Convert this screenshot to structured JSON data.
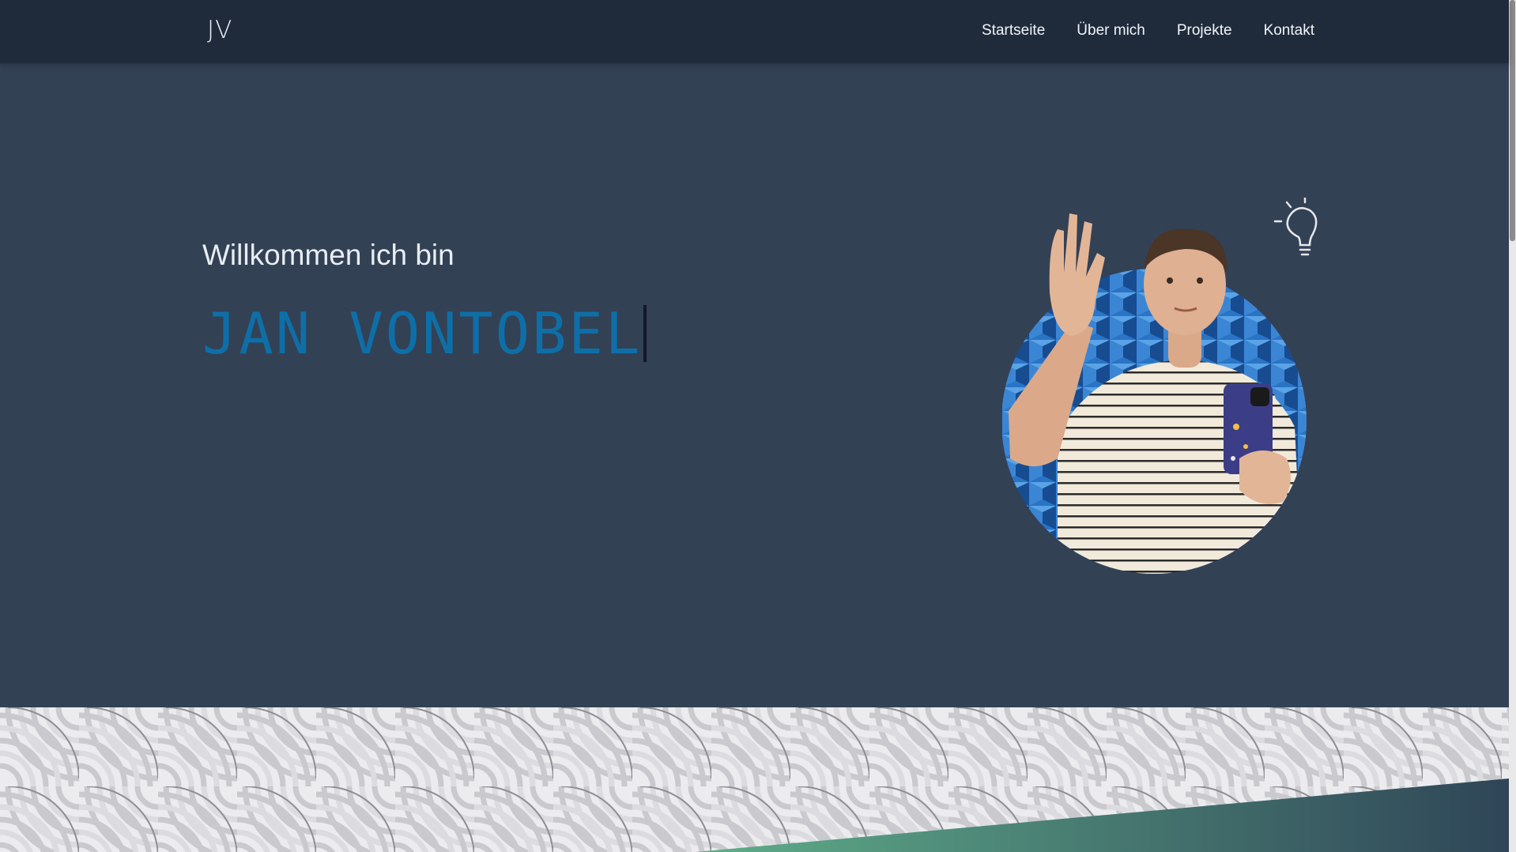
{
  "header": {
    "logo": "JV",
    "nav": [
      {
        "label": "Startseite"
      },
      {
        "label": "Über mich"
      },
      {
        "label": "Projekte"
      },
      {
        "label": "Kontakt"
      }
    ]
  },
  "hero": {
    "greeting": "Willkommen ich bin",
    "name": "JAN VONTOBEL"
  },
  "colors": {
    "navbar": "#1f2a3b",
    "background": "#334155",
    "name_accent": "#0e6fa8",
    "gradient_start": "#5fae8a",
    "gradient_end": "#2f4557"
  },
  "icons": [
    "lightbulb-icon",
    "waving-person-portrait"
  ]
}
